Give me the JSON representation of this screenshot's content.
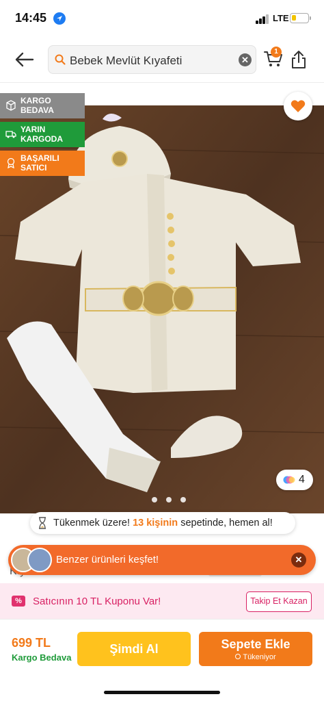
{
  "status_bar": {
    "time": "14:45",
    "network": "LTE",
    "battery_level": 0.25,
    "battery_color": "#f2c400"
  },
  "header": {
    "search_value": "Bebek Mevlüt Kıyafeti",
    "cart_count": "1",
    "icons": [
      "back-arrow-icon",
      "search-icon",
      "clear-icon",
      "cart-icon",
      "share-icon"
    ]
  },
  "badges": {
    "kargo": "KARGO\nBEDAVA",
    "yarin": "YARIN\nKARGODA",
    "basarili": "BAŞARILI\nSATICI"
  },
  "gallery": {
    "photo_count": "4",
    "dots": 3,
    "active_dot": 0
  },
  "stock": {
    "prefix": "Tükenmek üzere!",
    "count": "13 kişinin",
    "suffix": "sepetinde, hemen al!"
  },
  "title_peek": "Kıyafeti Mevlütlük Sünnetlik Takım",
  "discover": {
    "label": "Benzer ürünleri keşfet!"
  },
  "coupon": {
    "label": "Satıcının 10 TL Kuponu Var!",
    "button": "Takip Et Kazan"
  },
  "bottom": {
    "price": "699 TL",
    "shipping": "Kargo Bedava",
    "buy_now": "Şimdi Al",
    "add_to_cart": "Sepete Ekle",
    "stock_status": "Tükeniyor"
  },
  "colors": {
    "accent": "#f27a1a",
    "buy_now": "#ffc21d",
    "green": "#1f9b3a",
    "coupon_pink": "#d81f62"
  }
}
